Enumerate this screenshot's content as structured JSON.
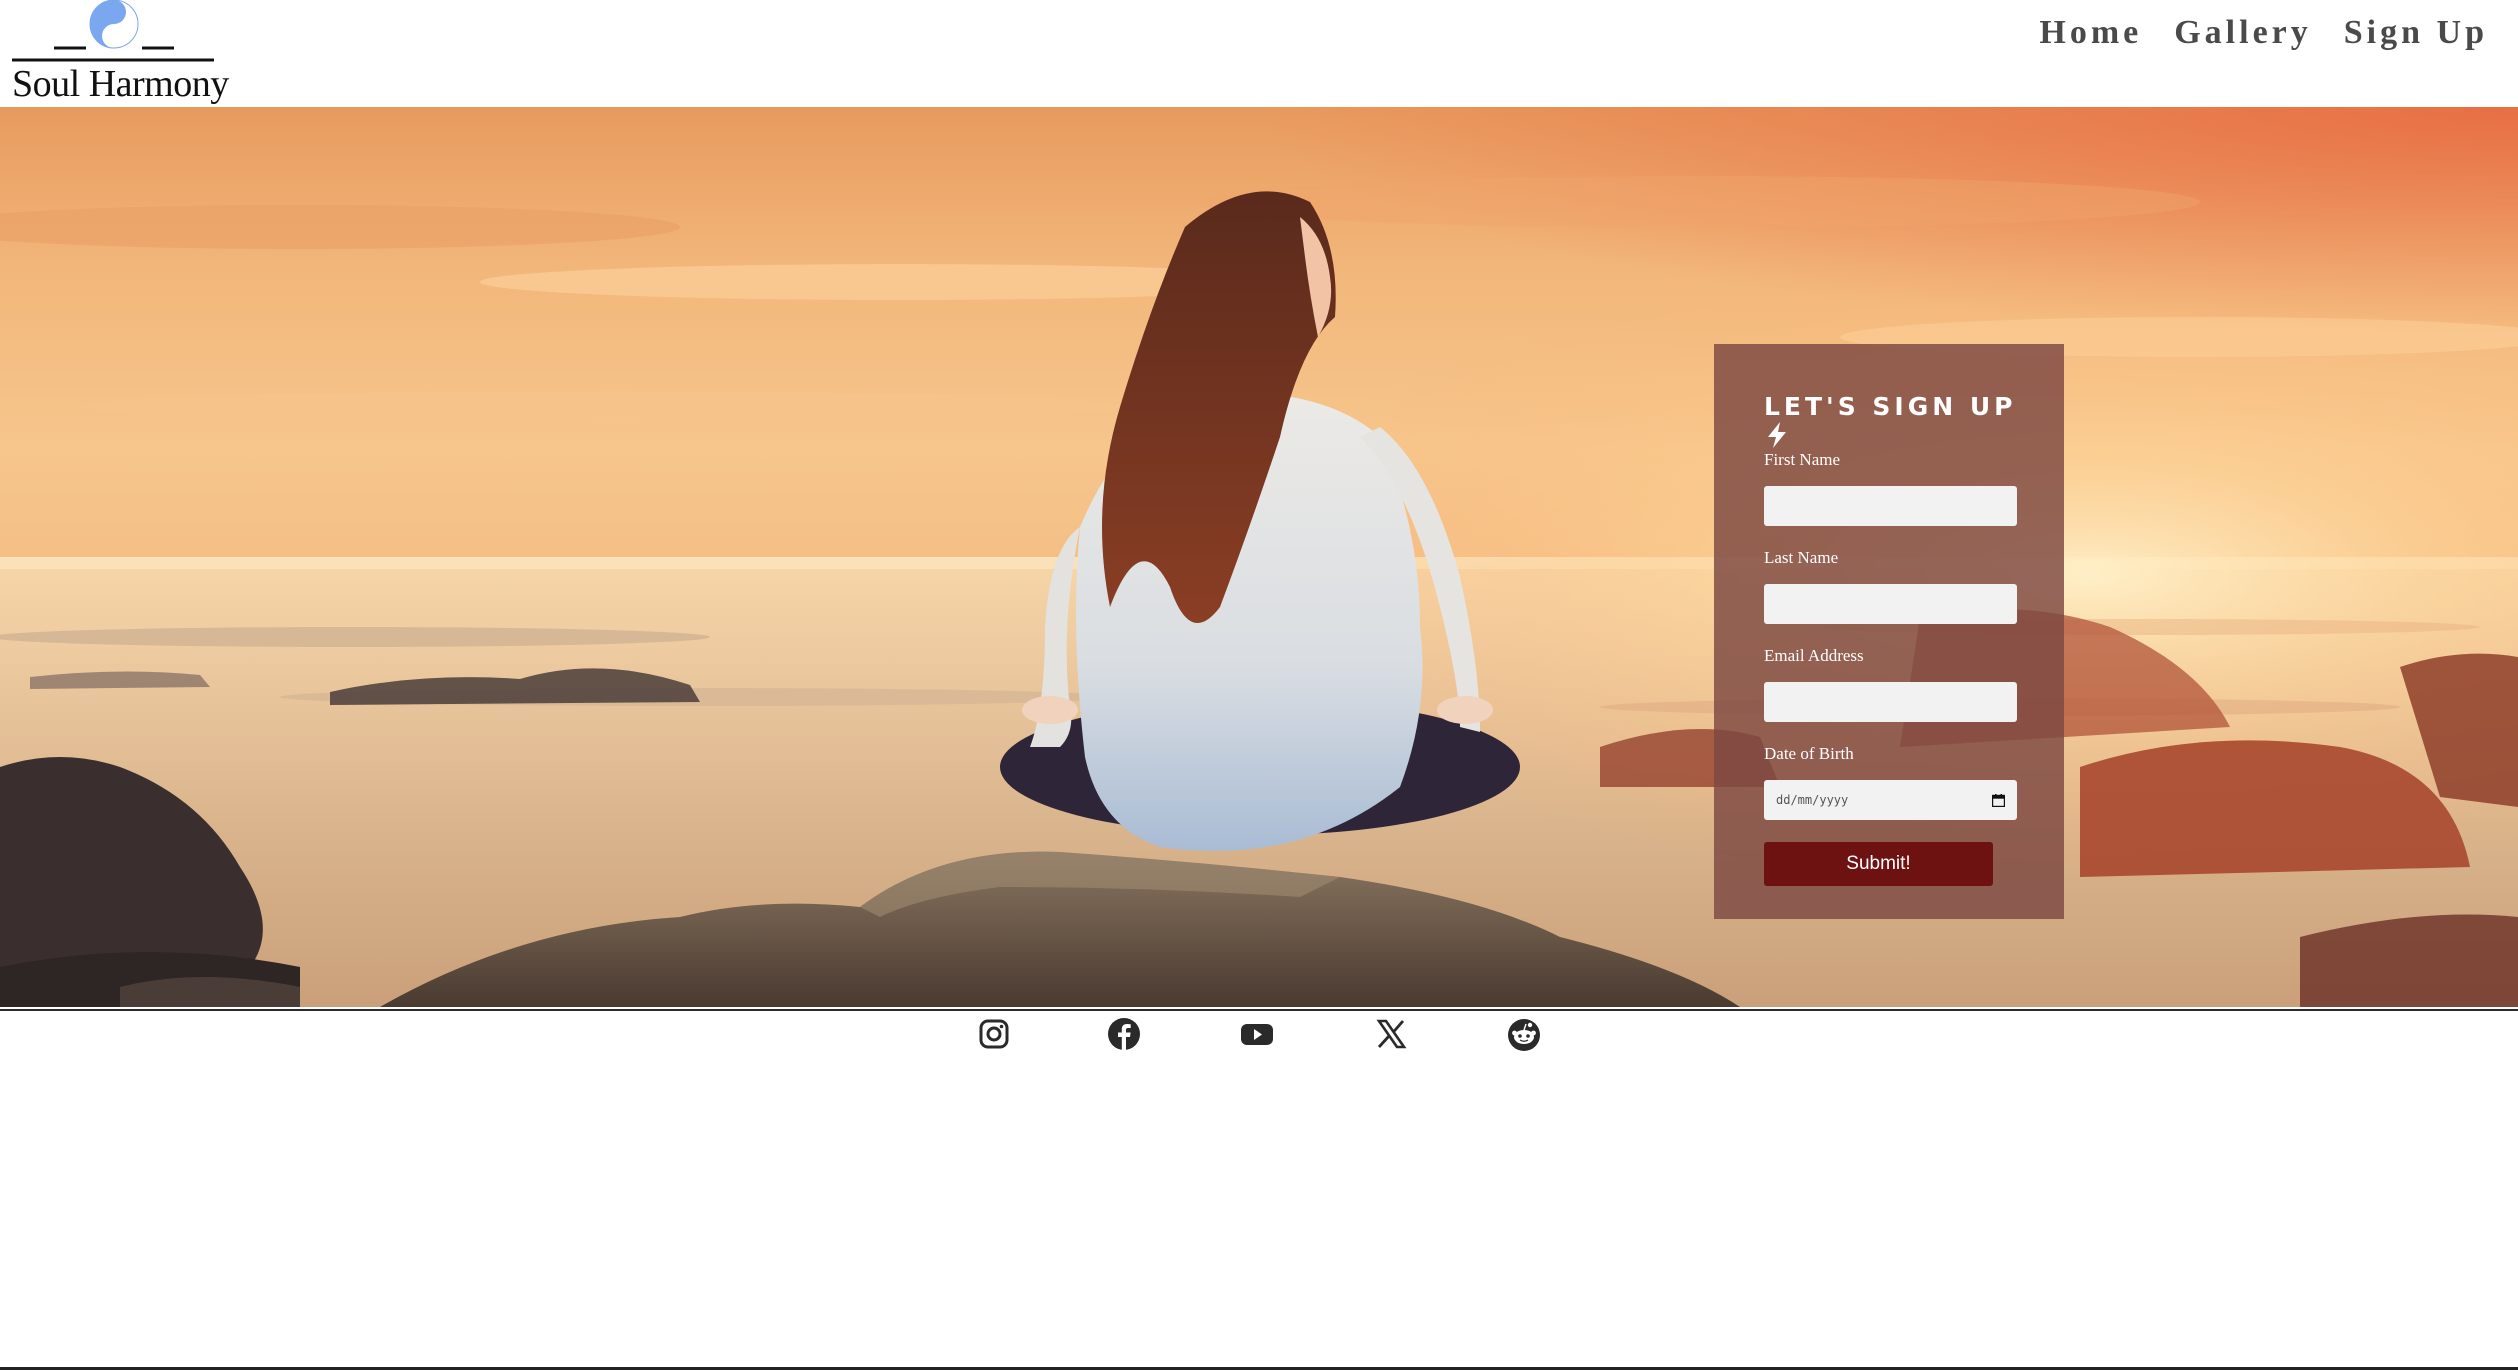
{
  "brand": {
    "name": "Soul Harmony",
    "logo_icon": "yin-yang-icon",
    "accent": "#7aa7f0"
  },
  "nav": {
    "items": [
      {
        "label": "Home"
      },
      {
        "label": "Gallery"
      },
      {
        "label": "Sign Up"
      }
    ]
  },
  "hero": {
    "image": "woman-meditating-on-rock-at-sunset"
  },
  "signup": {
    "title": "LET'S SIGN UP",
    "title_icon": "lightning-bolt-icon",
    "fields": [
      {
        "label": "First Name",
        "value": ""
      },
      {
        "label": "Last Name",
        "value": ""
      },
      {
        "label": "Email Address",
        "value": ""
      }
    ],
    "dob": {
      "label": "Date of Birth",
      "placeholder": "dd/mm/yyyy"
    },
    "submit_label": "Submit!",
    "card_color": "#7d4842",
    "button_color": "#6e1111"
  },
  "social": {
    "icons": [
      "instagram-icon",
      "facebook-icon",
      "youtube-icon",
      "x-icon",
      "reddit-icon"
    ]
  }
}
